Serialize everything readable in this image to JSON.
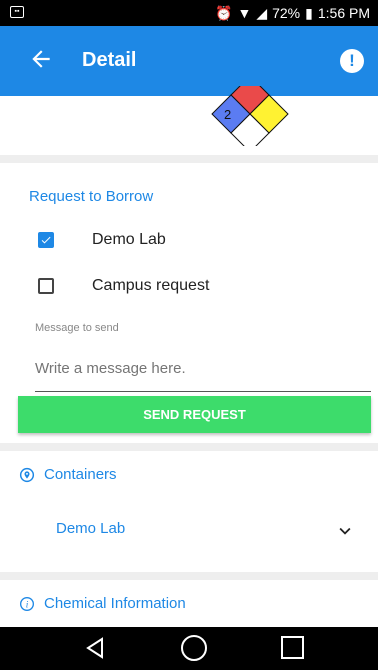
{
  "status_bar": {
    "battery": "72%",
    "time": "1:56 PM",
    "left_icon": "notification-icon"
  },
  "app_bar": {
    "title": "Detail",
    "back_icon": "back-arrow-icon",
    "action_icon": "alert-circle-icon"
  },
  "hazard_diamond": {
    "health_rating": "2",
    "colors": {
      "health": "#5b7cf2",
      "flammability": "#ea4a4a",
      "reactivity": "#fff232",
      "special": "#ffffff"
    }
  },
  "request": {
    "title": "Request to Borrow",
    "options": [
      {
        "label": "Demo Lab",
        "checked": true
      },
      {
        "label": "Campus request",
        "checked": false
      }
    ],
    "message_label": "Message to send",
    "message_placeholder": "Write a message here.",
    "send_label": "SEND REQUEST"
  },
  "containers": {
    "title": "Containers",
    "icon": "location-pin-icon",
    "items": [
      {
        "label": "Demo Lab",
        "icon": "chevron-down-icon"
      }
    ]
  },
  "chemical_info": {
    "title": "Chemical Information",
    "icon": "info-icon"
  },
  "colors": {
    "accent": "#1e88e5",
    "send_button": "#3ddc6b"
  }
}
